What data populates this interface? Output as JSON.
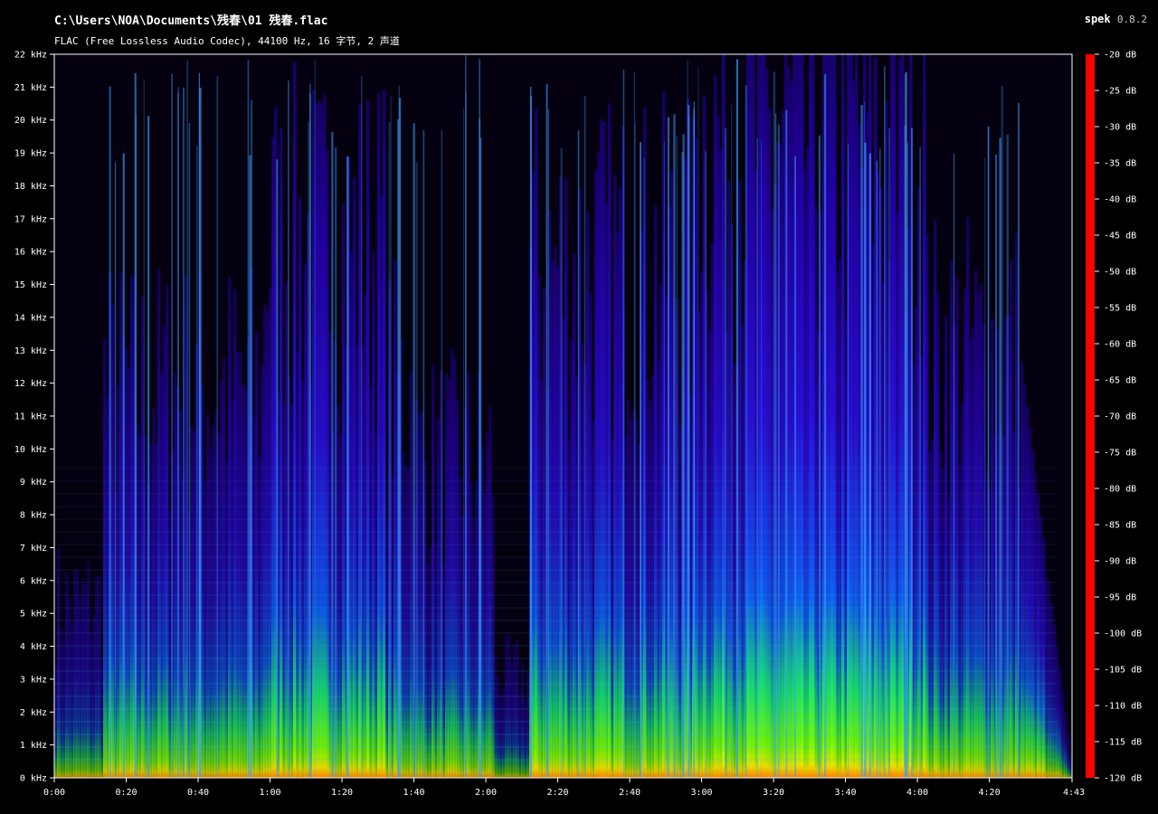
{
  "header": {
    "file_path": "C:\\Users\\NOA\\Documents\\残春\\01 残春.flac",
    "file_info": "FLAC (Free Lossless Audio Codec), 44100 Hz, 16 字节, 2 声道",
    "app_name": "spek",
    "app_version": "0.8.2"
  },
  "axes": {
    "frequency_labels": [
      "0 kHz",
      "1 kHz",
      "2 kHz",
      "3 kHz",
      "4 kHz",
      "5 kHz",
      "6 kHz",
      "7 kHz",
      "8 kHz",
      "9 kHz",
      "10 kHz",
      "11 kHz",
      "12 kHz",
      "13 kHz",
      "14 kHz",
      "15 kHz",
      "16 kHz",
      "17 kHz",
      "18 kHz",
      "19 kHz",
      "20 kHz",
      "21 kHz",
      "22 kHz"
    ],
    "time_labels": [
      "0:00",
      "0:20",
      "0:40",
      "1:00",
      "1:20",
      "1:40",
      "2:00",
      "2:20",
      "2:40",
      "3:00",
      "3:20",
      "3:40",
      "4:00",
      "4:20"
    ],
    "time_end_label": "4:43",
    "duration_seconds": 283,
    "max_khz": 22
  },
  "color_scale": {
    "db_labels": [
      "-20 dB",
      "-25 dB",
      "-30 dB",
      "-35 dB",
      "-40 dB",
      "-45 dB",
      "-50 dB",
      "-55 dB",
      "-60 dB",
      "-65 dB",
      "-70 dB",
      "-75 dB",
      "-80 dB",
      "-85 dB",
      "-90 dB",
      "-95 dB",
      "-100 dB",
      "-105 dB",
      "-110 dB",
      "-115 dB",
      "-120 dB"
    ],
    "colors": [
      "#ff0000",
      "#ff6a00",
      "#ffb000",
      "#ffff00",
      "#80ff00",
      "#00ff40",
      "#00ffc0",
      "#00b0ff",
      "#0040ff",
      "#2000e0",
      "#3a00a0",
      "#1a0030",
      "#000000"
    ]
  }
}
